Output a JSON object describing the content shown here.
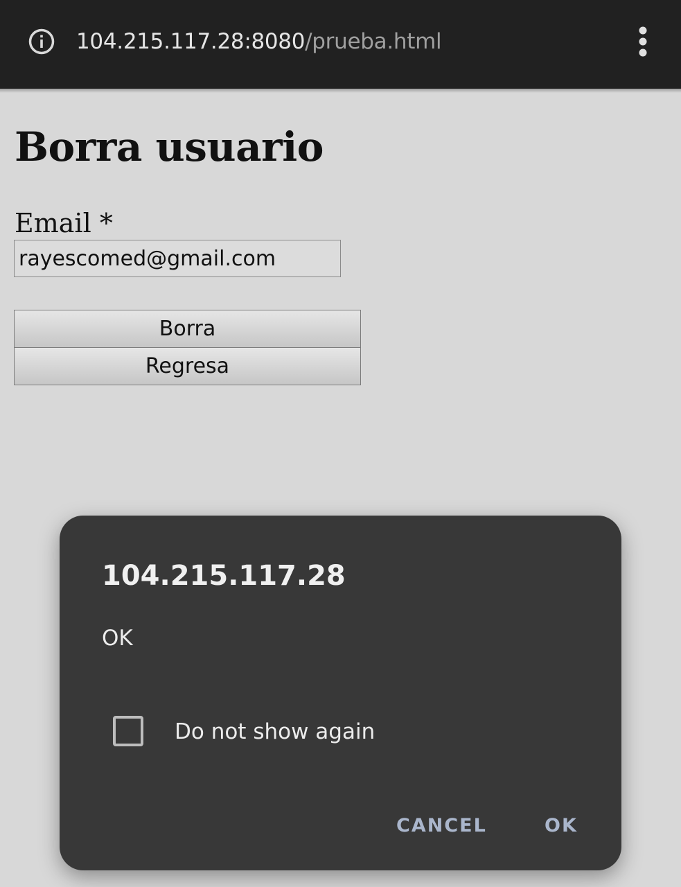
{
  "browser": {
    "url_host": "104.215.117.28:8080",
    "url_path": "/prueba.html",
    "info_icon": "info-circle-icon",
    "menu_icon": "more-vertical-icon"
  },
  "page": {
    "title": "Borra usuario",
    "email_label": "Email *",
    "email_value": "rayescomed@gmail.com",
    "delete_button": "Borra",
    "back_button": "Regresa"
  },
  "dialog": {
    "title": "104.215.117.28",
    "message": "OK",
    "checkbox_label": "Do not show again",
    "checkbox_checked": false,
    "cancel_label": "CANCEL",
    "ok_label": "OK"
  },
  "colors": {
    "browser_bar": "#212121",
    "page_background": "#d8d8d8",
    "dialog_background": "#383838",
    "dialog_button_text": "#aab6cc"
  }
}
